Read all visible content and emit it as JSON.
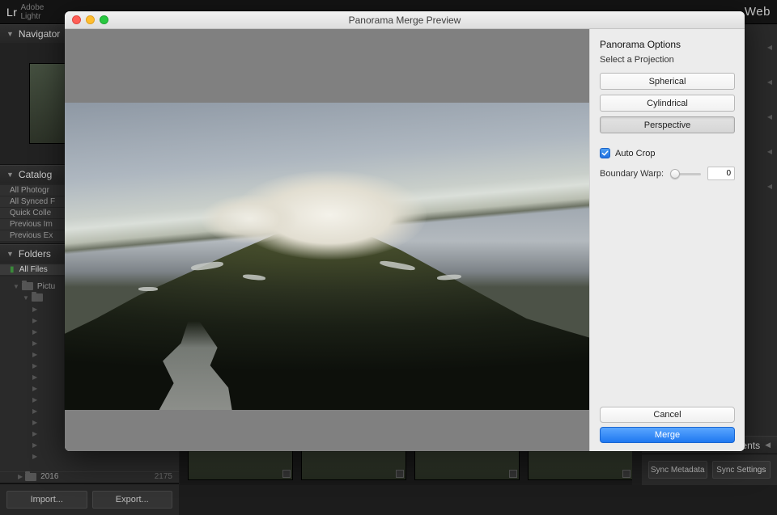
{
  "app": {
    "logo_mark": "Lr",
    "logo_sub_top": "Adobe",
    "logo_sub_bot": "Lightr",
    "top_right": "Web"
  },
  "left": {
    "navigator": "Navigator",
    "catalog": {
      "title": "Catalog",
      "items": [
        "All Photogr",
        "All Synced F",
        "Quick Colle",
        "Previous Im",
        "Previous Ex"
      ]
    },
    "folders": {
      "title": "Folders",
      "root": "All Files",
      "tree": [
        {
          "indent": 1,
          "label": "Pictu"
        },
        {
          "indent": 2,
          "label": ""
        },
        {
          "indent": 2,
          "label": ""
        },
        {
          "indent": 2,
          "label": ""
        },
        {
          "indent": 2,
          "label": ""
        },
        {
          "indent": 2,
          "label": ""
        },
        {
          "indent": 2,
          "label": ""
        },
        {
          "indent": 2,
          "label": ""
        },
        {
          "indent": 2,
          "label": ""
        },
        {
          "indent": 2,
          "label": ""
        },
        {
          "indent": 2,
          "label": ""
        }
      ],
      "bottom": {
        "label": "2016",
        "count": "2175"
      }
    },
    "buttons": {
      "import": "Import...",
      "export": "Export..."
    }
  },
  "right": {
    "comments": "Comments",
    "buttons": {
      "sync_meta": "Sync Metadata",
      "sync_settings": "Sync Settings"
    }
  },
  "modal": {
    "title": "Panorama Merge Preview",
    "options_title": "Panorama Options",
    "options_sub": "Select a Projection",
    "projections": [
      {
        "label": "Spherical",
        "active": false
      },
      {
        "label": "Cylindrical",
        "active": false
      },
      {
        "label": "Perspective",
        "active": true
      }
    ],
    "auto_crop": {
      "label": "Auto Crop",
      "checked": true
    },
    "boundary_warp": {
      "label": "Boundary Warp:",
      "value": "0"
    },
    "cancel": "Cancel",
    "merge": "Merge"
  }
}
